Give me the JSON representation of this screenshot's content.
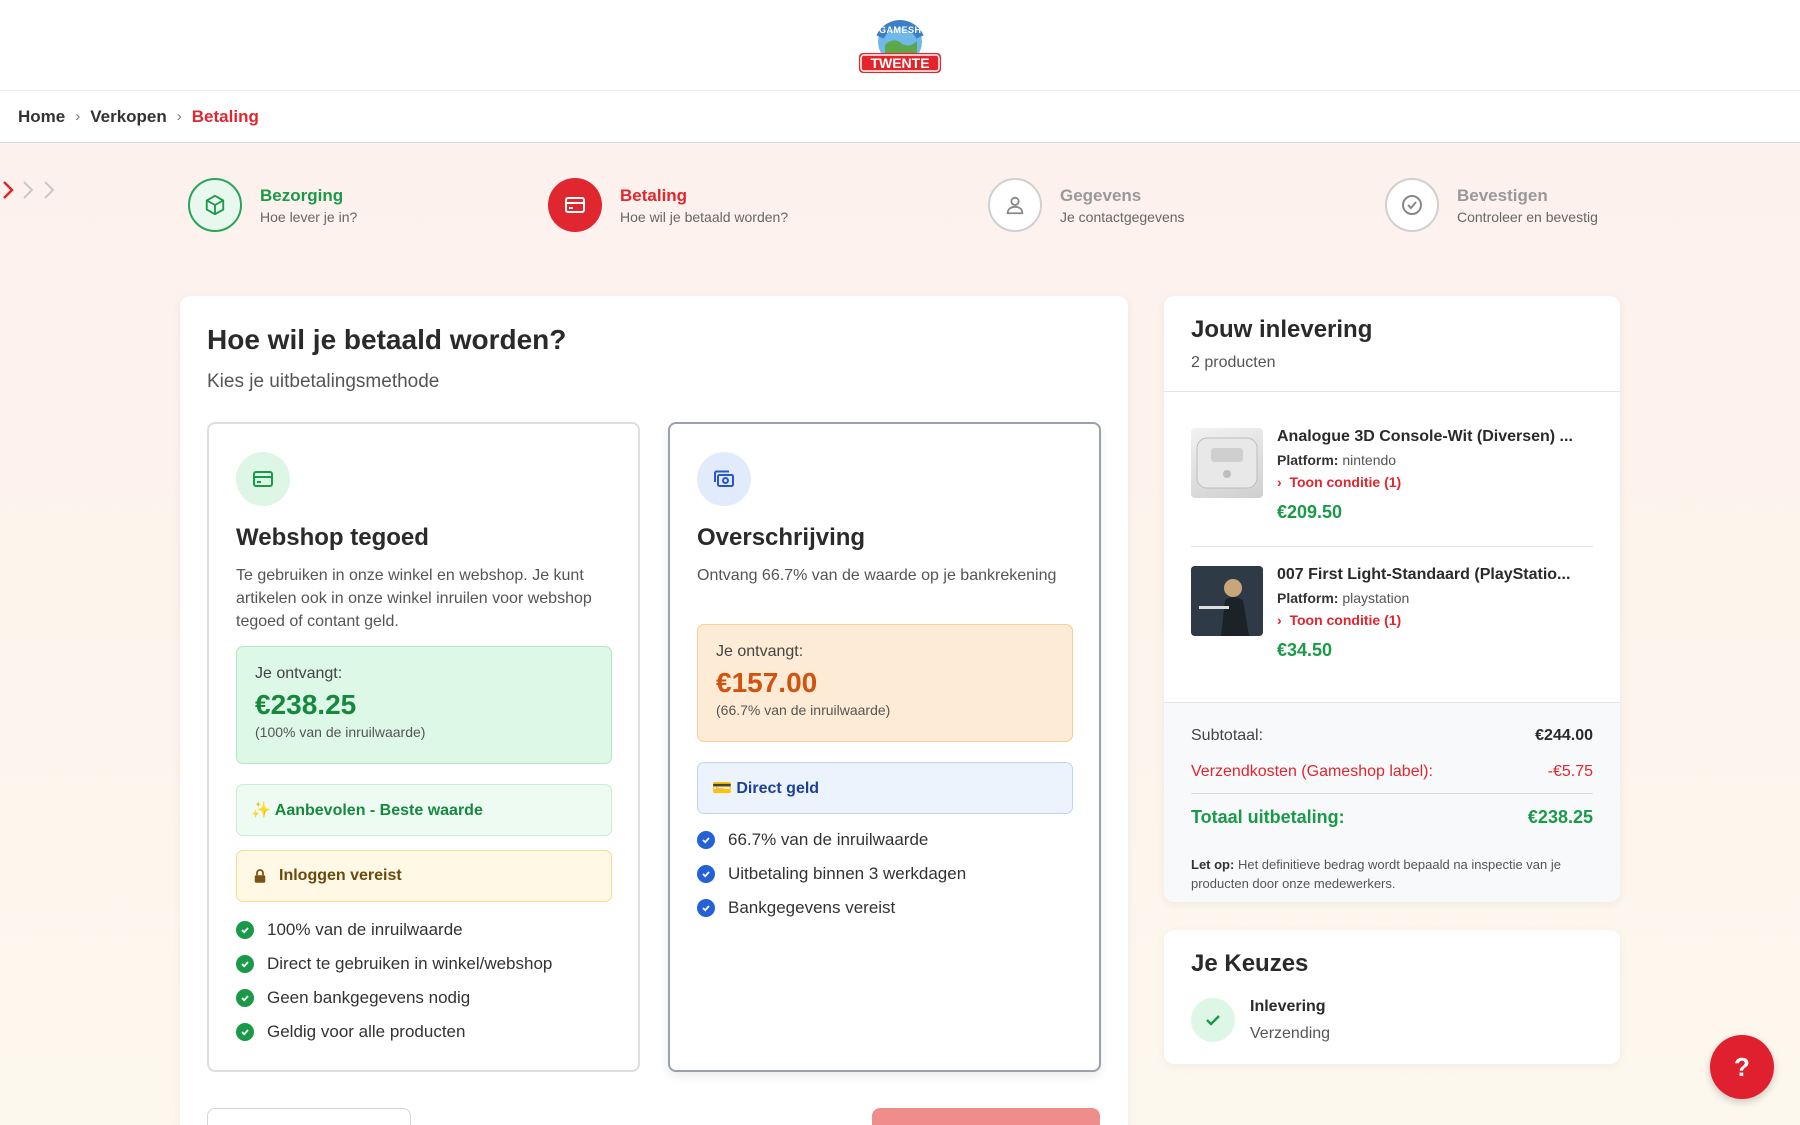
{
  "brand": {
    "logo_top": "GAMESHOP",
    "logo_bottom": "TWENTE",
    "accent": "#e0262f",
    "green": "#1a9a48"
  },
  "breadcrumb": {
    "items": [
      "Home",
      "Verkopen",
      "Betaling"
    ]
  },
  "steps": [
    {
      "title": "Bezorging",
      "subtitle": "Hoe lever je in?",
      "state": "done",
      "icon": "box-icon"
    },
    {
      "title": "Betaling",
      "subtitle": "Hoe wil je betaald worden?",
      "state": "active",
      "icon": "card-icon"
    },
    {
      "title": "Gegevens",
      "subtitle": "Je contactgegevens",
      "state": "todo",
      "icon": "user-icon"
    },
    {
      "title": "Bevestigen",
      "subtitle": "Controleer en bevestig",
      "state": "todo",
      "icon": "check-circle-icon"
    }
  ],
  "main": {
    "title": "Hoe wil je betaald worden?",
    "subtitle": "Kies je uitbetalingsmethode",
    "options": [
      {
        "title": "Webshop tegoed",
        "description": "Te gebruiken in onze winkel en webshop. Je kunt artikelen ook in onze winkel inruilen voor webshop tegoed of contant geld.",
        "receive_label": "Je ontvangt:",
        "amount": "€238.25",
        "amount_note": "(100% van de inruilwaarde)",
        "badge_recommended": "✨ Aanbevolen - Beste waarde",
        "badge_login": "Inloggen vereist",
        "features": [
          "100% van de inruilwaarde",
          "Direct te gebruiken in winkel/webshop",
          "Geen bankgegevens nodig",
          "Geldig voor alle producten"
        ]
      },
      {
        "title": "Overschrijving",
        "description": "Ontvang 66.7% van de waarde op je bankrekening",
        "receive_label": "Je ontvangt:",
        "amount": "€157.00",
        "amount_note": "(66.7% van de inruilwaarde)",
        "badge_direct": "💳 Direct geld",
        "features": [
          "66.7% van de inruilwaarde",
          "Uitbetaling binnen 3 werkdagen",
          "Bankgegevens vereist"
        ]
      }
    ]
  },
  "summary": {
    "title": "Jouw inlevering",
    "count": "2 producten",
    "items": [
      {
        "name": "Analogue 3D Console-Wit (Diversen) ...",
        "platform_label": "Platform:",
        "platform": "nintendo",
        "condition": "Toon conditie (1)",
        "price": "€209.50"
      },
      {
        "name": "007 First Light-Standaard (PlayStatio...",
        "platform_label": "Platform:",
        "platform": "playstation",
        "condition": "Toon conditie (1)",
        "price": "€34.50"
      }
    ],
    "subtotal_label": "Subtotaal:",
    "subtotal": "€244.00",
    "shipping_label": "Verzendkosten (Gameshop label):",
    "shipping": "-€5.75",
    "total_label": "Totaal uitbetaling:",
    "total": "€238.25",
    "note_label": "Let op:",
    "note": "Het definitieve bedrag wordt bepaald na inspectie van je producten door onze medewerkers."
  },
  "choices": {
    "title": "Je Keuzes",
    "item_title": "Inlevering",
    "item_value": "Verzending"
  },
  "help": {
    "label": "?"
  }
}
